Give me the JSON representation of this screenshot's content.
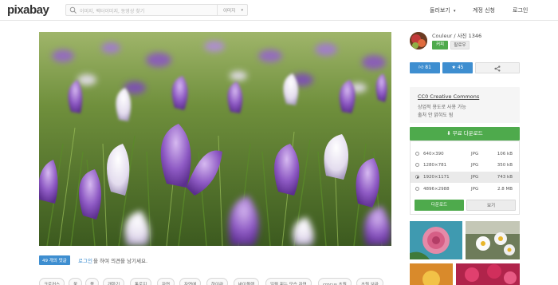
{
  "header": {
    "logo": "pixabay",
    "search_placeholder": "이미지, 벡터이미지, 동영상 찾기",
    "search_type": "이미지",
    "nav": {
      "browse": "둘러보기",
      "signup": "계정 신청",
      "login": "로그인"
    }
  },
  "author": {
    "name": "Couleur",
    "photo_count": "/ 사진 1346",
    "coffee_label": "커피",
    "follow_label": "팔로우"
  },
  "stats": {
    "likes": "81",
    "favorites": "45"
  },
  "license": {
    "title": "CC0 Creative Commons",
    "line1": "상업적 용도로 사용 가능",
    "line2": "출처 안 밝혀도 됨"
  },
  "download": {
    "main_label": "무료 다운로드",
    "options": [
      {
        "resolution": "640×390",
        "format": "JPG",
        "size": "106 kB",
        "selected": false
      },
      {
        "resolution": "1280×781",
        "format": "JPG",
        "size": "350 kB",
        "selected": false
      },
      {
        "resolution": "1920×1171",
        "format": "JPG",
        "size": "743 kB",
        "selected": true
      },
      {
        "resolution": "4896×2988",
        "format": "JPG",
        "size": "2.8 MB",
        "selected": false
      }
    ],
    "download_label": "다운로드",
    "view_label": "보기"
  },
  "comments": {
    "count_label": "49 개의 댓글",
    "login_link": "로그인",
    "prompt": "을 하여 의견을 남기세요."
  },
  "tags": [
    "크로커스",
    "꽃",
    "봄",
    "개화기",
    "통로지",
    "자연",
    "자연에",
    "하이라",
    "바이올렛",
    "일찍 피는 모습 자연",
    "crocus 초원",
    "초원 보라"
  ],
  "colors": {
    "accent_blue": "#3e8ed0",
    "accent_green": "#4eaa4c"
  },
  "icons": [
    "search-icon",
    "chevron-down-icon",
    "thumbs-up-icon",
    "star-icon",
    "share-icon",
    "download-icon"
  ]
}
